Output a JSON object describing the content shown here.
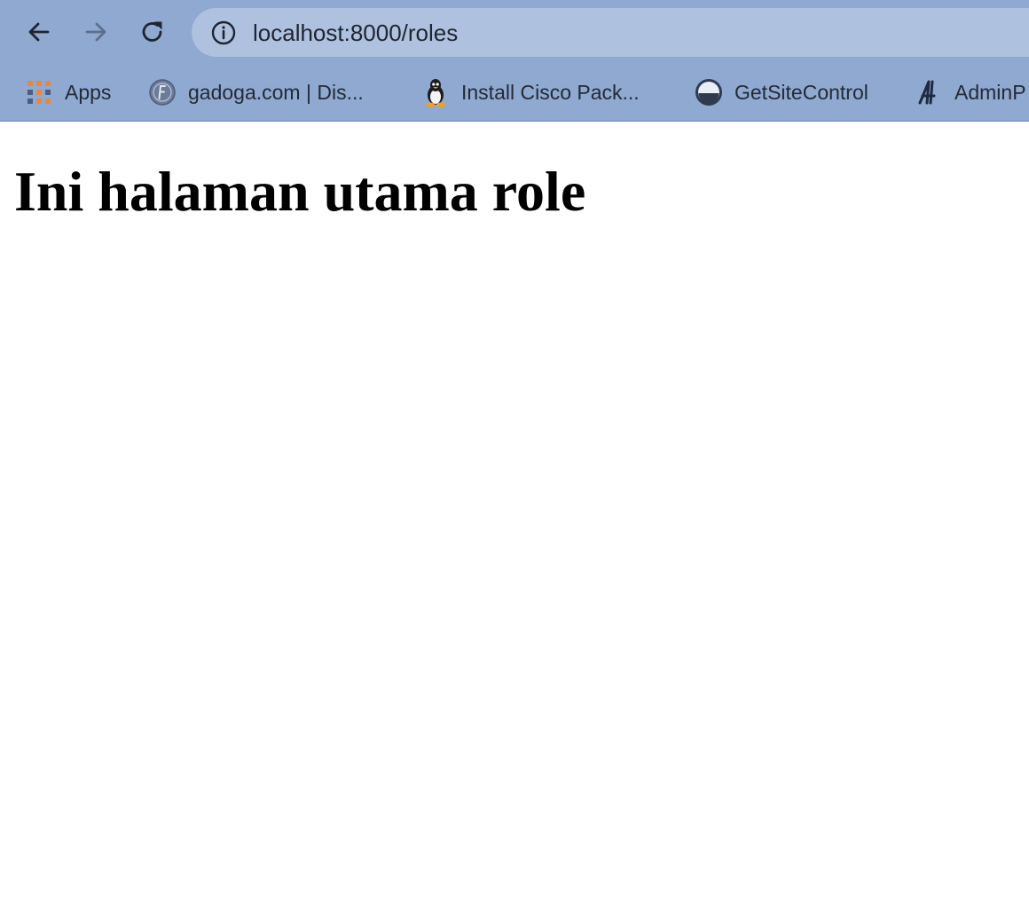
{
  "browser": {
    "address_bar": {
      "url": "localhost:8000/roles"
    },
    "bookmarks": [
      {
        "label": "Apps",
        "icon": "apps-grid-icon"
      },
      {
        "label": "gadoga.com | Dis...",
        "icon": "gadoga-icon"
      },
      {
        "label": "Install Cisco Pack...",
        "icon": "linux-penguin-icon"
      },
      {
        "label": "GetSiteControl",
        "icon": "getsitecontrol-icon"
      },
      {
        "label": "AdminP",
        "icon": "adminpro-icon"
      }
    ]
  },
  "page": {
    "heading": "Ini halaman utama role"
  }
}
